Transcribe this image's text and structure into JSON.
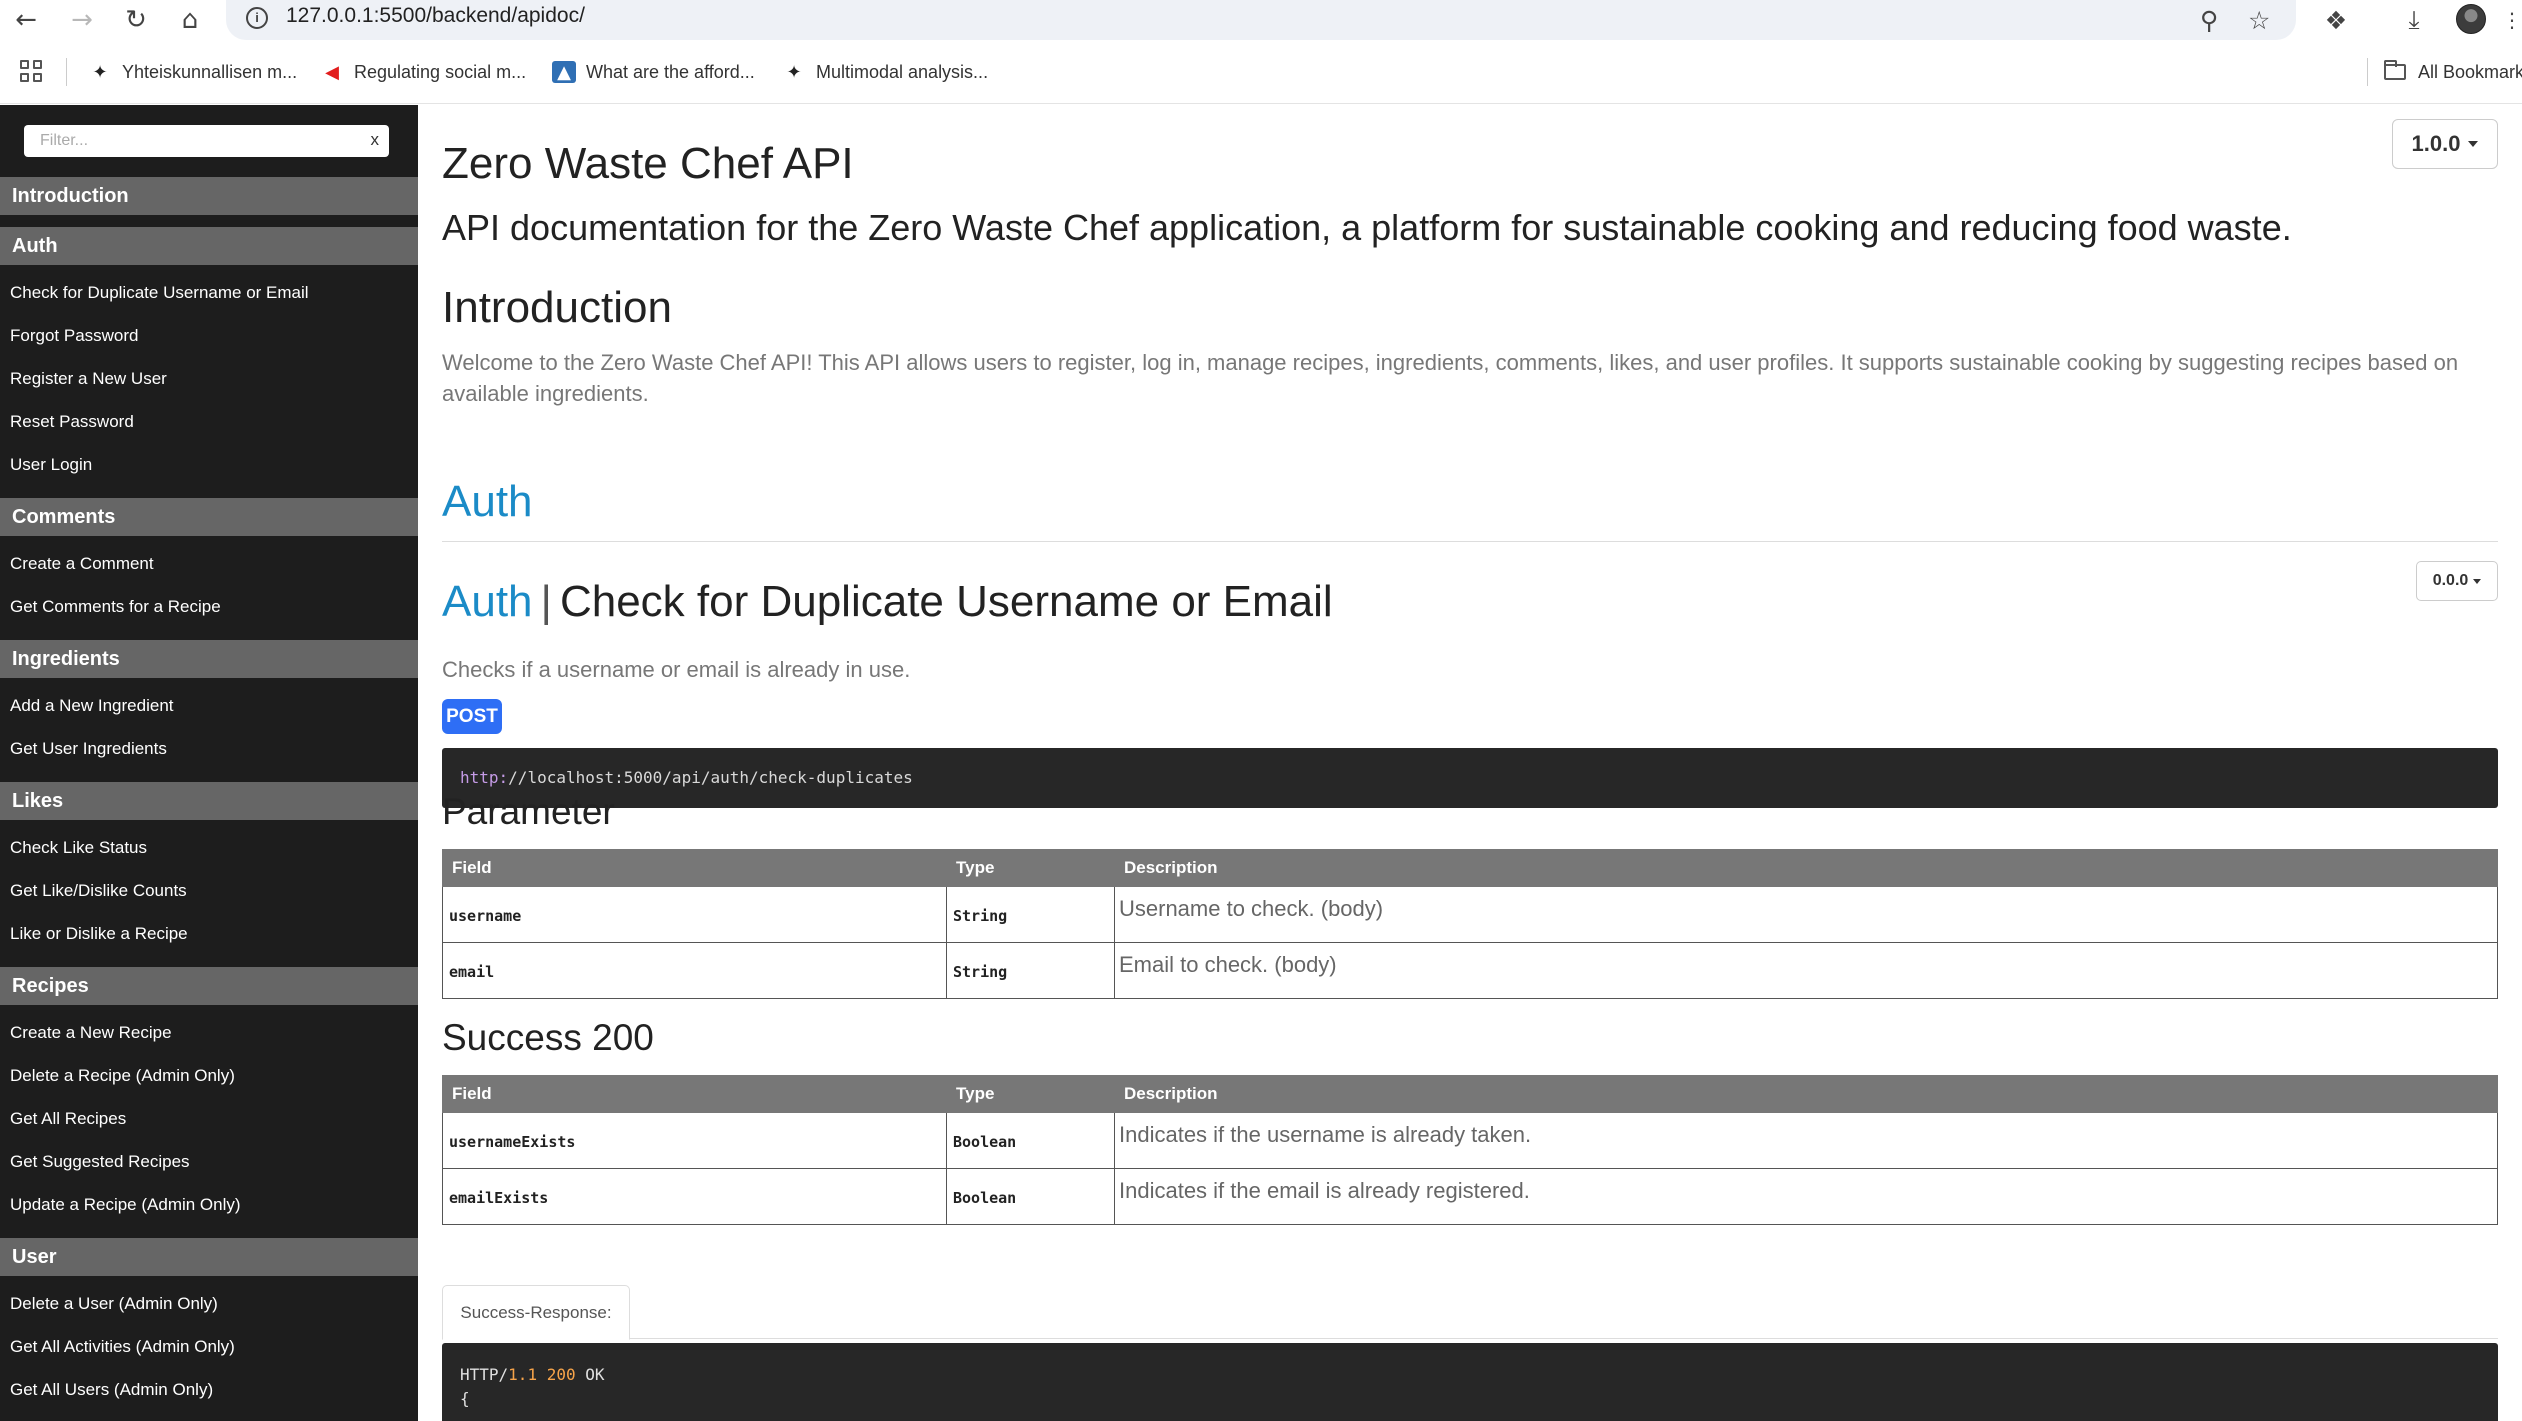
{
  "browser": {
    "url": "127.0.0.1:5500/backend/apidoc/",
    "bookmarks": [
      {
        "label": "Yhteiskunnallisen m...",
        "icon": "bird-icon"
      },
      {
        "label": "Regulating social m...",
        "icon": "red-arrow-icon"
      },
      {
        "label": "What are the afford...",
        "icon": "image-icon"
      },
      {
        "label": "Multimodal analysis...",
        "icon": "bird-icon"
      }
    ],
    "all_bookmarks_label": "All Bookmarks"
  },
  "sidebar": {
    "filter_placeholder": "Filter...",
    "filter_clear": "x",
    "groups": [
      {
        "title": "Introduction",
        "items": []
      },
      {
        "title": "Auth",
        "items": [
          "Check for Duplicate Username or Email",
          "Forgot Password",
          "Register a New User",
          "Reset Password",
          "User Login"
        ]
      },
      {
        "title": "Comments",
        "items": [
          "Create a Comment",
          "Get Comments for a Recipe"
        ]
      },
      {
        "title": "Ingredients",
        "items": [
          "Add a New Ingredient",
          "Get User Ingredients"
        ]
      },
      {
        "title": "Likes",
        "items": [
          "Check Like Status",
          "Get Like/Dislike Counts",
          "Like or Dislike a Recipe"
        ]
      },
      {
        "title": "Recipes",
        "items": [
          "Create a New Recipe",
          "Delete a Recipe (Admin Only)",
          "Get All Recipes",
          "Get Suggested Recipes",
          "Update a Recipe (Admin Only)"
        ]
      },
      {
        "title": "User",
        "items": [
          "Delete a User (Admin Only)",
          "Get All Activities (Admin Only)",
          "Get All Users (Admin Only)"
        ]
      }
    ]
  },
  "main": {
    "version": "1.0.0",
    "title": "Zero Waste Chef API",
    "description": "API documentation for the Zero Waste Chef application, a platform for sustainable cooking and reducing food waste.",
    "intro_title": "Introduction",
    "intro_text": "Welcome to the Zero Waste Chef API! This API allows users to register, log in, manage recipes, ingredients, comments, likes, and user profiles. It supports sustainable cooking by suggesting recipes based on available ingredients.",
    "section_title": "Auth",
    "endpoint": {
      "group": "Auth",
      "separator": "|",
      "name": "Check for Duplicate Username or Email",
      "version": "0.0.0",
      "description": "Checks if a username or email is already in use.",
      "method": "POST",
      "url_scheme": "http:",
      "url_rest": "//localhost:5000/api/auth/check-duplicates",
      "parameter_title": "Parameter",
      "table_headers": {
        "field": "Field",
        "type": "Type",
        "description": "Description"
      },
      "parameters": [
        {
          "field": "username",
          "type": "String",
          "description": "Username to check. (body)"
        },
        {
          "field": "email",
          "type": "String",
          "description": "Email to check. (body)"
        }
      ],
      "success_title": "Success 200",
      "success_fields": [
        {
          "field": "usernameExists",
          "type": "Boolean",
          "description": "Indicates if the username is already taken."
        },
        {
          "field": "emailExists",
          "type": "Boolean",
          "description": "Indicates if the email is already registered."
        }
      ],
      "response_tab": "Success-Response:",
      "response_http": "HTTP/",
      "response_version": "1.1",
      "response_code": "200",
      "response_status": "OK",
      "response_brace": "{"
    }
  }
}
